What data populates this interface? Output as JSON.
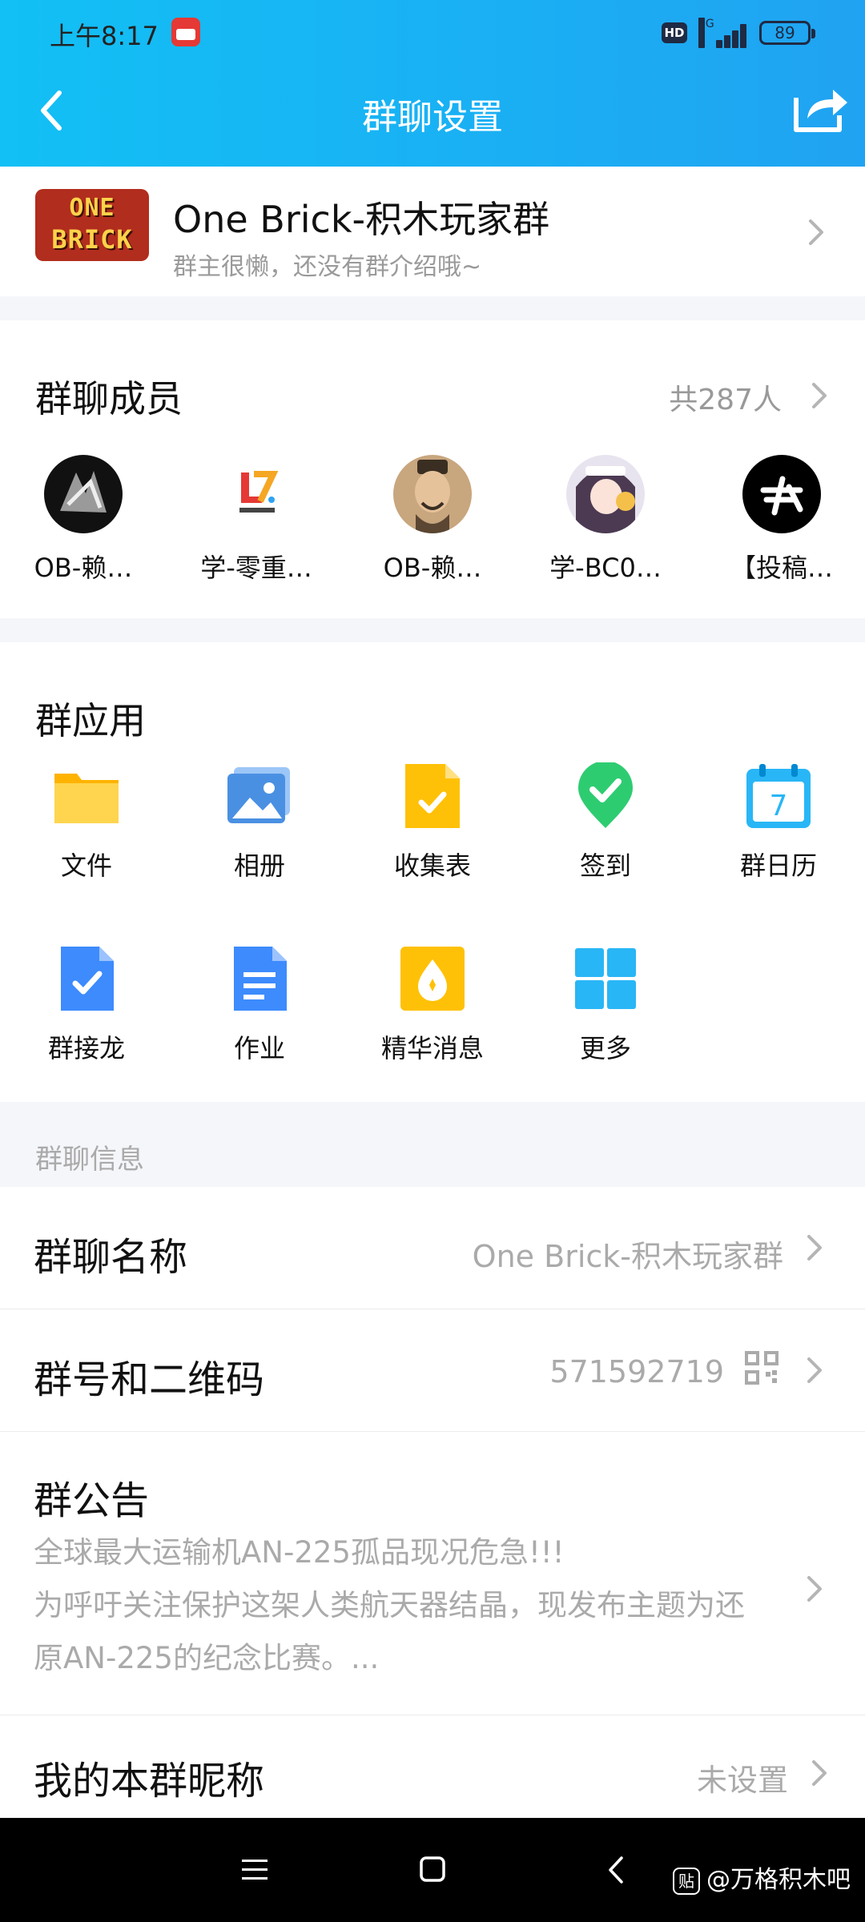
{
  "status": {
    "time": "上午8:17",
    "hd": "HD",
    "network": "5G",
    "battery": "89"
  },
  "header": {
    "title": "群聊设置"
  },
  "group": {
    "logo_line1": "ONE",
    "logo_line2": "BRICK",
    "name": "One Brick-积木玩家群",
    "description": "群主很懒，还没有群介绍哦~"
  },
  "members": {
    "title": "群聊成员",
    "count": "共287人",
    "items": [
      {
        "name": "OB-赖…"
      },
      {
        "name": "学-零重…"
      },
      {
        "name": "OB-赖…"
      },
      {
        "name": "学-BC0…"
      },
      {
        "name": "【投稿…"
      }
    ]
  },
  "apps": {
    "title": "群应用",
    "items": [
      {
        "label": "文件",
        "icon": "folder-icon",
        "color": "#ffc107"
      },
      {
        "label": "相册",
        "icon": "photo-album-icon",
        "color": "#4a90e2"
      },
      {
        "label": "收集表",
        "icon": "form-icon",
        "color": "#ffc107"
      },
      {
        "label": "签到",
        "icon": "checkin-pin-icon",
        "color": "#2ecc71"
      },
      {
        "label": "群日历",
        "icon": "calendar-icon",
        "color": "#29b6f6",
        "calendar_day": "7"
      },
      {
        "label": "群接龙",
        "icon": "relay-icon",
        "color": "#3d8bfd"
      },
      {
        "label": "作业",
        "icon": "homework-icon",
        "color": "#3d8bfd"
      },
      {
        "label": "精华消息",
        "icon": "essence-icon",
        "color": "#ffc107"
      },
      {
        "label": "更多",
        "icon": "more-grid-icon",
        "color": "#29b6f6"
      }
    ]
  },
  "info": {
    "section_title": "群聊信息",
    "group_name_label": "群聊名称",
    "group_name_value": "One Brick-积木玩家群",
    "group_number_label": "群号和二维码",
    "group_number_value": "571592719",
    "notice_label": "群公告",
    "notice_line1": "全球最大运输机AN-225孤品现况危急!!!",
    "notice_line2": "为呼吁关注保护这架人类航天器结晶，现发布主题为还",
    "notice_line3": "原AN-225的纪念比赛。...",
    "nickname_label": "我的本群昵称",
    "nickname_value": "未设置"
  },
  "watermark": {
    "icon_text": "贴",
    "text": "@万格积木吧"
  }
}
